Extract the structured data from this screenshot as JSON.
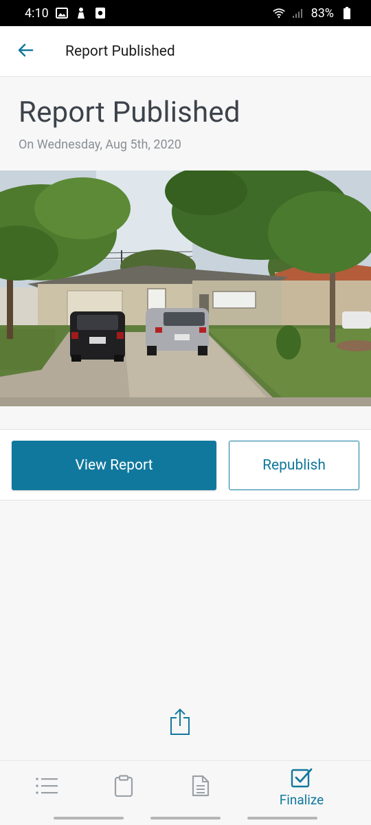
{
  "status_bar": {
    "time": "4:10",
    "battery": "83%"
  },
  "app_bar": {
    "title": "Report Published",
    "back_icon": "arrow-left-icon"
  },
  "header": {
    "title": "Report Published",
    "subtitle": "On Wednesday, Aug 5th, 2020"
  },
  "photo": {
    "alt": "Street view of a house with two cars in the driveway"
  },
  "actions": {
    "view_report_label": "View Report",
    "republish_label": "Republish"
  },
  "share": {
    "icon": "share-upload-icon"
  },
  "bottom_nav": {
    "items": [
      {
        "icon": "list-icon",
        "label": "",
        "active": false
      },
      {
        "icon": "clipboard-icon",
        "label": "",
        "active": false
      },
      {
        "icon": "document-icon",
        "label": "",
        "active": false
      },
      {
        "icon": "checkbox-icon",
        "label": "Finalize",
        "active": true
      }
    ]
  },
  "colors": {
    "accent": "#11789d",
    "background": "#f7f7f7",
    "title_text": "#3c434a",
    "subtitle_text": "#8a8f94"
  }
}
